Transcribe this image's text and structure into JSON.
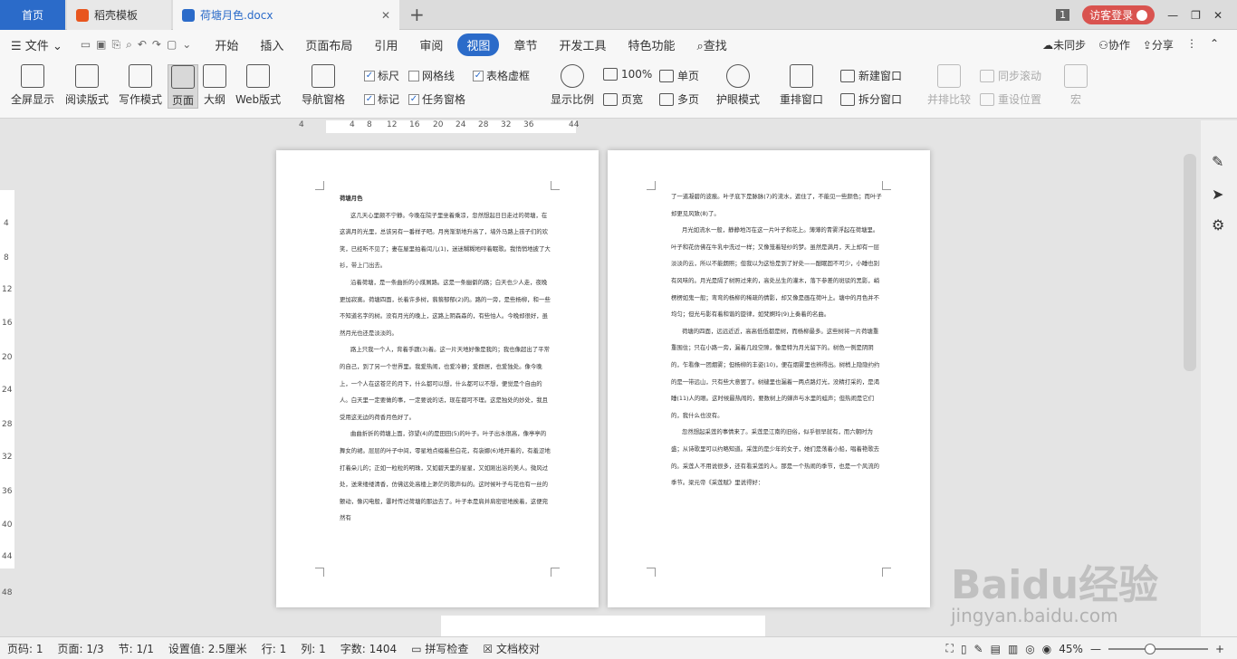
{
  "tabs": {
    "home": "首页",
    "template": "稻壳模板",
    "doc": "荷塘月色.docx",
    "badge": "1",
    "login": "访客登录"
  },
  "menu": {
    "file": "文件",
    "items": [
      "开始",
      "插入",
      "页面布局",
      "引用",
      "审阅",
      "视图",
      "章节",
      "开发工具",
      "特色功能"
    ],
    "search": "查找",
    "sync": "未同步",
    "collab": "协作",
    "share": "分享"
  },
  "toolbar": {
    "fullscreen": "全屏显示",
    "read": "阅读版式",
    "write": "写作模式",
    "page": "页面",
    "outline": "大纲",
    "web": "Web版式",
    "nav": "导航窗格",
    "ruler": "标尺",
    "grid": "网格线",
    "tableframe": "表格虚框",
    "mark": "标记",
    "taskpane": "任务窗格",
    "zoomratio": "显示比例",
    "pct100": "100%",
    "single": "单页",
    "pagewidth": "页宽",
    "multi": "多页",
    "eye": "护眼模式",
    "arrange": "重排窗口",
    "newwin": "新建窗口",
    "splitwin": "拆分窗口",
    "compare": "并排比较",
    "syncscroll": "同步滚动",
    "resetpos": "重设位置",
    "macro": "宏"
  },
  "ruler": {
    "ticks": [
      "4",
      "4",
      "8",
      "12",
      "16",
      "20",
      "24",
      "28",
      "32",
      "36",
      "44"
    ]
  },
  "vruler": {
    "ticks": [
      "4",
      "8",
      "12",
      "16",
      "20",
      "24",
      "28",
      "32",
      "36",
      "40",
      "44",
      "48"
    ]
  },
  "doc": {
    "title": "荷塘月色",
    "p1": [
      "这几天心里颇不宁静。今晚在院子里坐着乘凉，忽然想起日日走过的荷塘，在这满月的光里，总该另有一番样子吧。月亮渐渐地升高了，墙外马路上孩子们的欢笑，已经听不见了；妻在屋里拍着闰儿(1)，迷迷糊糊地哼着眠歌。我悄悄地披了大衫，带上门出去。",
      "沿着荷塘，是一条曲折的小煤屑路。这是一条幽僻的路；白天也少人走，夜晚更加寂寞。荷塘四面，长着许多树，蓊蓊郁郁(2)的。路的一旁，是些杨柳，和一些不知道名字的树。没有月光的晚上，这路上阴森森的，有些怕人。今晚却很好，虽然月光也还是淡淡的。",
      "路上只我一个人，背着手踱(3)着。这一片天地好像是我的；我也像超出了平常的自己，到了另一个世界里。我爱热闹，也爱冷静；爱群居，也爱独处。像今晚上，一个人在这苍茫的月下，什么都可以想，什么都可以不想，便觉是个自由的人。白天里一定要做的事，一定要说的话，现在都可不理。这是独处的妙处，我且受用这无边的荷香月色好了。",
      "曲曲折折的荷塘上面，弥望(4)的是田田(5)的叶子。叶子出水很高，像亭亭的舞女的裙。层层的叶子中间，零星地点缀着些白花，有袅娜(6)地开着的，有羞涩地打着朵儿的；正如一粒粒的明珠，又如碧天里的星星，又如刚出浴的美人。微风过处，送来缕缕清香，仿佛远处高楼上渺茫的歌声似的。这时候叶子与花也有一丝的颤动，像闪电般，霎时传过荷塘的那边去了。叶子本是肩并肩密密地挨着，这便宛然有"
    ],
    "p2": [
      "了一道凝碧的波痕。叶子底下是脉脉(7)的流水，遮住了，不能见一些颜色；而叶子却更见风致(8)了。",
      "月光如流水一般，静静地泻在这一片叶子和花上。薄薄的青雾浮起在荷塘里。叶子和花仿佛在牛乳中洗过一样；又像笼着轻纱的梦。虽然是满月，天上却有一层淡淡的云，所以不能朗照；但我以为这恰是到了好处——酣眠固不可少，小睡也别有风味的。月光是隔了树照过来的，高处丛生的灌木，落下参差的斑驳的黑影，峭楞楞如鬼一般；弯弯的杨柳的稀疏的倩影，却又像是画在荷叶上。塘中的月色并不均匀；但光与影有着和谐的旋律，如梵婀玲(9)上奏着的名曲。",
      "荷塘的四面，远远近近，高高低低都是树，而杨柳最多。这些树将一片荷塘重重围住；只在小路一旁，漏着几段空隙，像是特为月光留下的。树色一例是阴阴的，乍看像一团烟雾；但杨柳的丰姿(10)，便在烟雾里也辨得出。树梢上隐隐约约的是一带远山，只有些大意罢了。树缝里也漏着一两点路灯光，没精打采的，是渴睡(11)人的眼。这时候最热闹的，要数树上的蝉声与水里的蛙声；但热闹是它们的，我什么也没有。",
      "忽然想起采莲的事情来了。采莲是江南的旧俗，似乎很早就有，而六朝时为盛；从诗歌里可以约略知道。采莲的是少年的女子，她们是荡着小船，唱着艳歌去的。采莲人不用说很多，还有看采莲的人。那是一个热闹的季节，也是一个风流的季节。梁元帝《采莲赋》里说得好："
    ]
  },
  "status": {
    "pagecode": "页码: 1",
    "page": "页面: 1/3",
    "section": "节: 1/1",
    "setting": "设置值: 2.5厘米",
    "row": "行: 1",
    "col": "列: 1",
    "words": "字数: 1404",
    "spell": "拼写检查",
    "proof": "文档校对",
    "zoom": "45%"
  },
  "watermark": {
    "brand": "Baidu经验",
    "url": "jingyan.baidu.com"
  }
}
